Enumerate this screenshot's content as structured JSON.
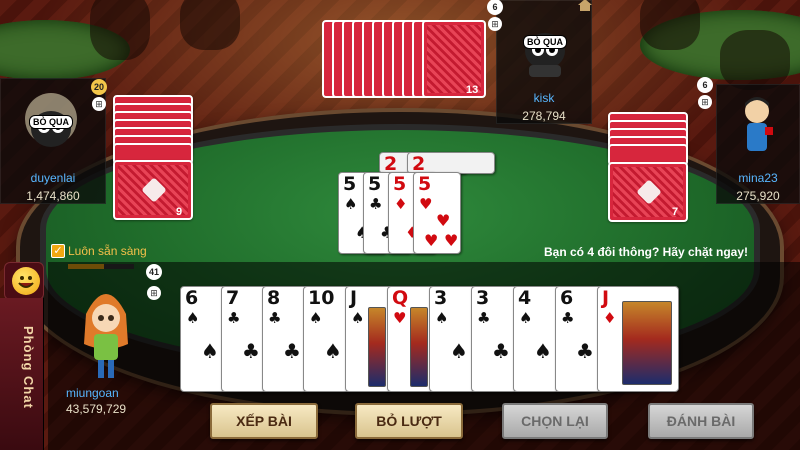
{
  "players": {
    "top": {
      "name": "kisk",
      "money": "278,794",
      "status": "BỎ QUA",
      "level": "6",
      "cards_left": "13"
    },
    "left": {
      "name": "duyenlai",
      "money": "1,474,860",
      "status": "BỎ QUA",
      "level": "20",
      "cards_left": "9"
    },
    "right": {
      "name": "mina23",
      "money": "275,920",
      "level": "6",
      "cards_left": "7"
    },
    "self": {
      "name": "miungoan",
      "money": "43,579,729",
      "level": "41"
    }
  },
  "ready": {
    "label": "Luôn sẵn sàng",
    "checked": true,
    "progress": 0.55
  },
  "hint_message": "Bạn có 4 đôi thông? Hãy chặt ngay!",
  "chat": {
    "label": "Phòng Chat"
  },
  "played_cards": [
    {
      "rank": "2",
      "suit": "♥",
      "color": "red",
      "partial": true
    },
    {
      "rank": "2",
      "suit": "♥",
      "color": "red",
      "partial": true
    },
    {
      "rank": "5",
      "suit": "♠",
      "color": "black"
    },
    {
      "rank": "5",
      "suit": "♣",
      "color": "black"
    },
    {
      "rank": "5",
      "suit": "♦",
      "color": "red"
    },
    {
      "rank": "5",
      "suit": "♥",
      "color": "red"
    }
  ],
  "hand": [
    {
      "rank": "6",
      "suit": "♠",
      "color": "black"
    },
    {
      "rank": "7",
      "suit": "♣",
      "color": "black"
    },
    {
      "rank": "8",
      "suit": "♣",
      "color": "black"
    },
    {
      "rank": "10",
      "suit": "♠",
      "color": "black"
    },
    {
      "rank": "J",
      "suit": "♠",
      "color": "black",
      "face": true
    },
    {
      "rank": "Q",
      "suit": "♥",
      "color": "red",
      "face": true
    },
    {
      "rank": "3",
      "suit": "♠",
      "color": "black"
    },
    {
      "rank": "3",
      "suit": "♣",
      "color": "black"
    },
    {
      "rank": "4",
      "suit": "♠",
      "color": "black"
    },
    {
      "rank": "6",
      "suit": "♣",
      "color": "black"
    },
    {
      "rank": "J",
      "suit": "♦",
      "color": "red",
      "face": true
    }
  ],
  "buttons": {
    "arrange": "XẾP BÀI",
    "pass": "BỎ LƯỢT",
    "reselect": "CHỌN LẠI",
    "play": "ĐÁNH BÀI"
  },
  "icons": {
    "emoji": "smiley-icon",
    "home": "home-icon",
    "windows": "windows-icon"
  },
  "colors": {
    "felt": "#1f6b2a",
    "card_back": "#d7263d",
    "name": "#58b6ff",
    "accent": "#f2a812"
  }
}
